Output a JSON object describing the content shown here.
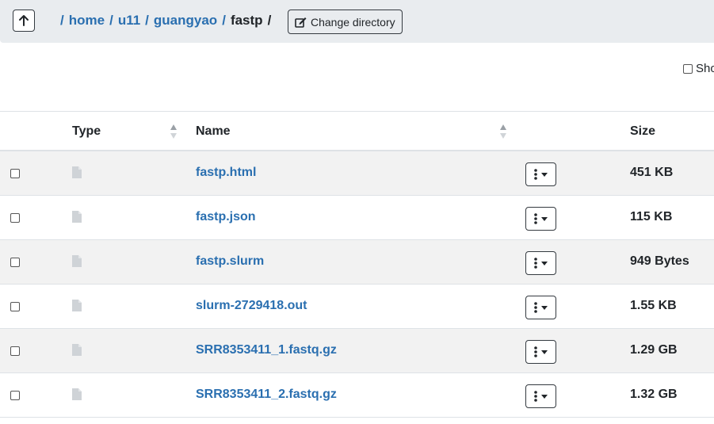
{
  "breadcrumb": {
    "items": [
      "home",
      "u11",
      "guangyao"
    ],
    "current": "fastp",
    "separator": "/"
  },
  "toolbar": {
    "change_directory_label": "Change directory",
    "show_label": "Sho"
  },
  "table": {
    "columns": {
      "type": "Type",
      "name": "Name",
      "size": "Size"
    },
    "rows": [
      {
        "name": "fastp.html",
        "size": "451 KB"
      },
      {
        "name": "fastp.json",
        "size": "115 KB"
      },
      {
        "name": "fastp.slurm",
        "size": "949 Bytes"
      },
      {
        "name": "slurm-2729418.out",
        "size": "1.55 KB"
      },
      {
        "name": "SRR8353411_1.fastq.gz",
        "size": "1.29 GB"
      },
      {
        "name": "SRR8353411_2.fastq.gz",
        "size": "1.32 GB"
      }
    ]
  },
  "colors": {
    "link": "#2a6fb0",
    "stripe": "#f2f2f2",
    "header_bg": "#e9ecef"
  },
  "icons": {
    "row_type": "file-icon",
    "row_menu": "kebab-menu-icon",
    "up": "arrow-up-icon",
    "edit": "edit-icon"
  }
}
